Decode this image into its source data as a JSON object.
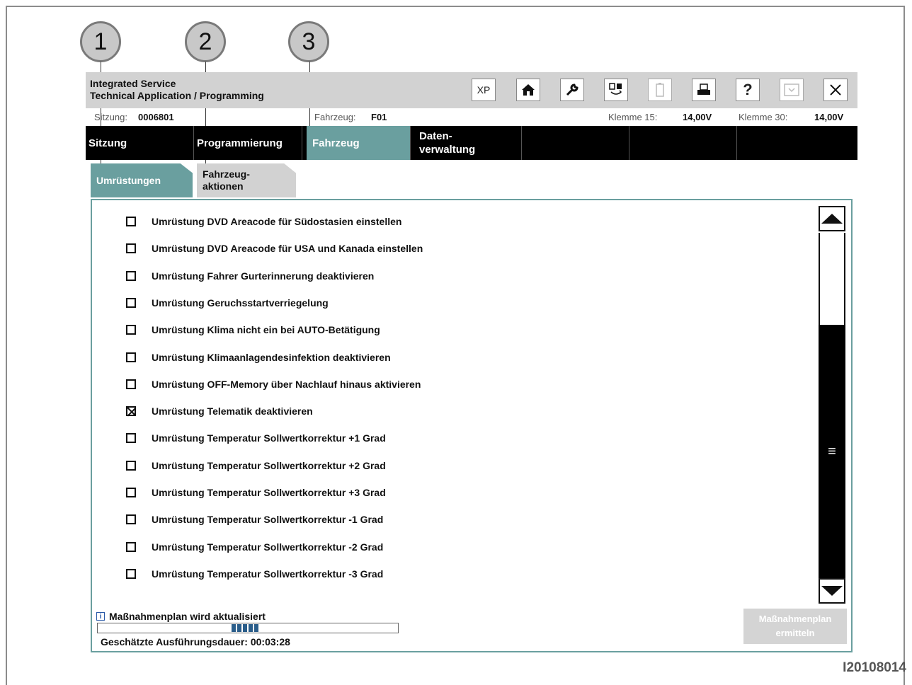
{
  "callouts": [
    "1",
    "2",
    "3"
  ],
  "app": {
    "title_line1": "Integrated Service",
    "title_line2": "Technical Application / Programming"
  },
  "toolbar": {
    "buttons": [
      {
        "icon": "xp-icon",
        "label": "XP"
      },
      {
        "icon": "home-icon"
      },
      {
        "icon": "wrench-icon"
      },
      {
        "icon": "transfer-icon"
      },
      {
        "icon": "battery-icon",
        "disabled": true
      },
      {
        "icon": "print-icon"
      },
      {
        "icon": "help-icon",
        "label": "?"
      },
      {
        "icon": "collapse-icon",
        "disabled": true
      },
      {
        "icon": "close-icon"
      }
    ]
  },
  "status": {
    "session_label": "Sitzung:",
    "session_value": "0006801",
    "vehicle_label": "Fahrzeug:",
    "vehicle_value": "F01",
    "k15_label": "Klemme 15:",
    "k15_value": "14,00V",
    "k30_label": "Klemme 30:",
    "k30_value": "14,00V"
  },
  "nav": {
    "items": [
      {
        "label": "Sitzung",
        "active": false
      },
      {
        "label": "Programmierung",
        "active": false
      },
      {
        "label": "Fahrzeug",
        "active": true
      },
      {
        "label": "Daten-\nverwaltung",
        "active": false
      },
      {
        "label": "",
        "active": false
      },
      {
        "label": "",
        "active": false
      },
      {
        "label": "",
        "active": false
      }
    ]
  },
  "tabs": [
    {
      "label": "Umrüstungen",
      "active": true
    },
    {
      "label": "Fahrzeug-\naktionen",
      "active": false
    }
  ],
  "list": {
    "items": [
      {
        "label": "Umrüstung DVD Areacode für Südostasien einstellen",
        "checked": false
      },
      {
        "label": "Umrüstung DVD Areacode für USA und Kanada einstellen",
        "checked": false
      },
      {
        "label": "Umrüstung Fahrer Gurterinnerung deaktivieren",
        "checked": false
      },
      {
        "label": "Umrüstung Geruchsstartverriegelung",
        "checked": false
      },
      {
        "label": "Umrüstung Klima nicht ein bei AUTO-Betätigung",
        "checked": false
      },
      {
        "label": "Umrüstung Klimaanlagendesinfektion deaktivieren",
        "checked": false
      },
      {
        "label": "Umrüstung OFF-Memory über Nachlauf hinaus aktivieren",
        "checked": false
      },
      {
        "label": "Umrüstung Telematik deaktivieren",
        "checked": true
      },
      {
        "label": "Umrüstung Temperatur Sollwertkorrektur +1 Grad",
        "checked": false
      },
      {
        "label": "Umrüstung Temperatur Sollwertkorrektur +2 Grad",
        "checked": false
      },
      {
        "label": "Umrüstung Temperatur Sollwertkorrektur +3 Grad",
        "checked": false
      },
      {
        "label": "Umrüstung Temperatur Sollwertkorrektur -1 Grad",
        "checked": false
      },
      {
        "label": "Umrüstung Temperatur Sollwertkorrektur -2 Grad",
        "checked": false
      },
      {
        "label": "Umrüstung Temperatur Sollwertkorrektur -3 Grad",
        "checked": false
      }
    ]
  },
  "footer": {
    "status_message": "Maßnahmenplan wird aktualisiert",
    "duration_text": "Geschätzte Ausführungsdauer: 00:03:28",
    "plan_button_label": "Maßnahmenplan\nermitteln"
  },
  "image_id": "I20108014"
}
